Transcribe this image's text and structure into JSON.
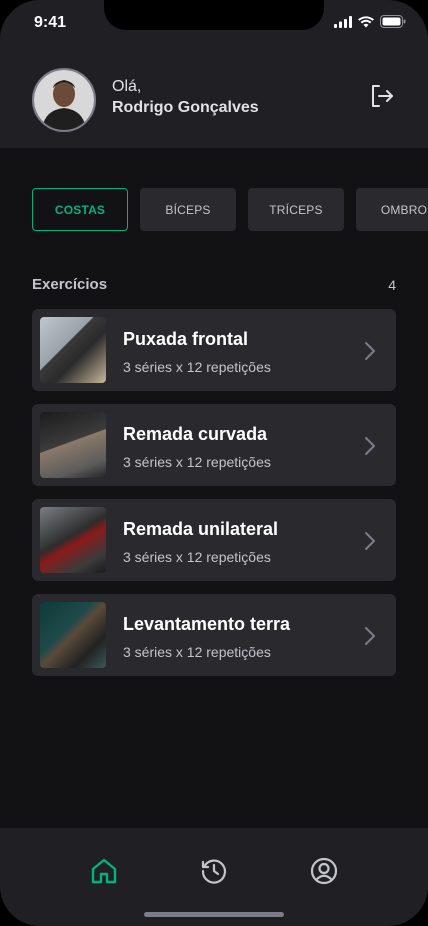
{
  "status_bar": {
    "time": "9:41"
  },
  "header": {
    "greeting": "Olá,",
    "user_name": "Rodrigo Gonçalves",
    "avatar_icon": "user-photo",
    "logout_icon": "sign-out-icon"
  },
  "groups": [
    {
      "label": "COSTAS",
      "active": true
    },
    {
      "label": "BÍCEPS",
      "active": false
    },
    {
      "label": "TRÍCEPS",
      "active": false
    },
    {
      "label": "OMBRO",
      "active": false
    }
  ],
  "exercises_section": {
    "title": "Exercícios",
    "count": "4"
  },
  "exercises": [
    {
      "name": "Puxada frontal",
      "details": "3 séries x 12 repetições"
    },
    {
      "name": "Remada curvada",
      "details": "3 séries x 12 repetições"
    },
    {
      "name": "Remada unilateral",
      "details": "3 séries x 12 repetições"
    },
    {
      "name": "Levantamento terra",
      "details": "3 séries x 12 repetições"
    }
  ],
  "tabs": [
    {
      "name": "home",
      "icon": "home-icon",
      "active": true
    },
    {
      "name": "history",
      "icon": "history-icon",
      "active": false
    },
    {
      "name": "profile",
      "icon": "user-circle-icon",
      "active": false
    }
  ],
  "colors": {
    "accent": "#00B37E",
    "background": "#121214",
    "surface": "#202024",
    "card": "#29292E"
  }
}
